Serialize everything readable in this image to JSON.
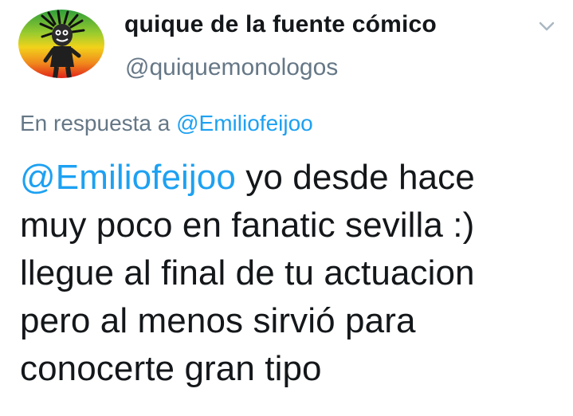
{
  "author": {
    "display_name": "quique de la fuente cómico",
    "handle": "@quiquemonologos",
    "avatar_icon": "rasta-cartoon-avatar"
  },
  "menu": {
    "caret_icon": "chevron-down-icon"
  },
  "reply_context": {
    "prefix": "En respuesta a",
    "mention": "@Emiliofeijoo"
  },
  "tweet": {
    "mention": "@Emiliofeijoo",
    "line1_rest": " yo desde hace",
    "line2": "muy poco en fanatic sevilla :)",
    "line3": "llegue al final de tu actuacion",
    "line4": "pero al menos sirvió para",
    "line5": "conocerte gran tipo"
  },
  "colors": {
    "link": "#1da1f2",
    "secondary_text": "#657786",
    "primary_text": "#14171a"
  }
}
